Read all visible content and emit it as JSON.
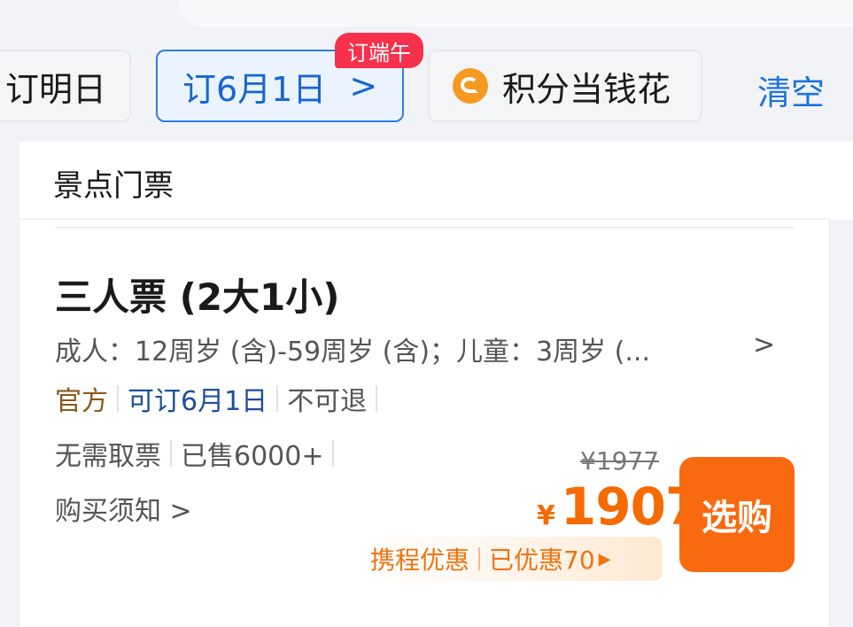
{
  "filters": {
    "tomorrow_label": "订明日",
    "date_label": "订6月1日",
    "date_chevron": ">",
    "badge_label": "订端午",
    "points_label": "积分当钱花",
    "clear_label": "清空"
  },
  "section": {
    "title": "景点门票"
  },
  "ticket": {
    "title": "三人票 (2大1小)",
    "age_desc": "成人：12周岁 (含)-59周岁 (含)；儿童：3周岁 (...",
    "age_chevron": ">",
    "tags": [
      "官方",
      "可订6月1日",
      "不可退"
    ],
    "info": [
      "无需取票",
      "已售6000+"
    ],
    "notice": "购买须知 >",
    "original_price": "¥1977",
    "currency": "¥",
    "price": "1907",
    "buy_label": "选购",
    "promo_name": "携程优惠",
    "promo_saving": "已优惠70",
    "promo_arrow": "▶"
  },
  "colors": {
    "accent": "#1766cf",
    "price": "#f56b00",
    "buy_button": "#f86a10",
    "badge": "#f7314b"
  }
}
